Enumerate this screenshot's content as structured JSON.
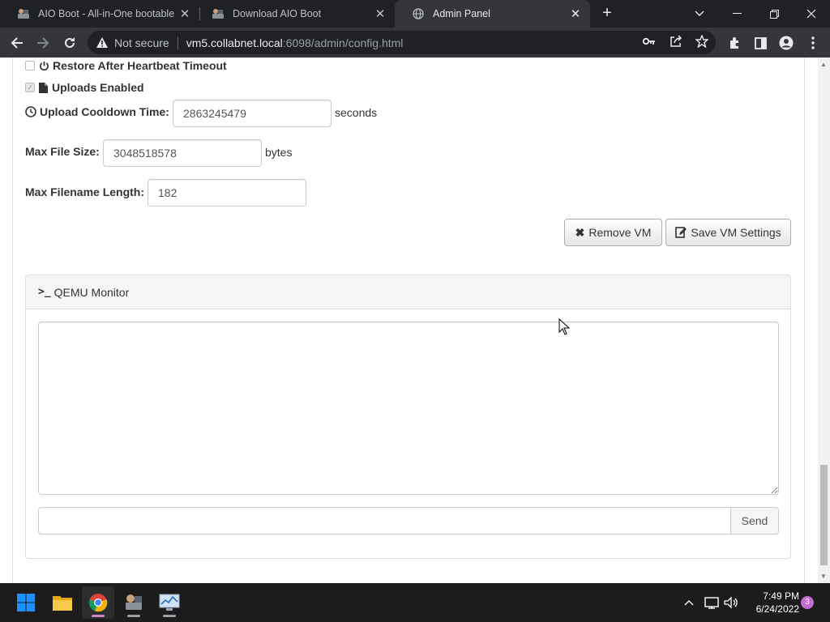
{
  "browser": {
    "tabs": [
      {
        "title": "AIO Boot - All-in-One bootable s",
        "icon": "aio-boot-favicon"
      },
      {
        "title": "Download AIO Boot",
        "icon": "aio-boot-favicon"
      },
      {
        "title": "Admin Panel",
        "icon": "globe-icon"
      }
    ],
    "address": {
      "security_label": "Not secure",
      "host": "vm5.collabnet.local",
      "rest": ":6098/admin/config.html"
    }
  },
  "form": {
    "restore_after_heartbeat": {
      "label": "Restore After Heartbeat Timeout",
      "checked": false
    },
    "uploads_enabled": {
      "label": "Uploads Enabled",
      "checked": true
    },
    "upload_cooldown": {
      "label": "Upload Cooldown Time:",
      "value": "2863245479",
      "unit": "seconds"
    },
    "max_file_size": {
      "label": "Max File Size:",
      "value": "3048518578",
      "unit": "bytes"
    },
    "max_filename_length": {
      "label": "Max Filename Length:",
      "value": "182"
    },
    "remove_vm_label": "Remove VM",
    "save_vm_label": "Save VM Settings"
  },
  "qemu": {
    "title": "QEMU Monitor",
    "prompt_symbol": ">_",
    "output": "",
    "command": "",
    "send_label": "Send"
  },
  "taskbar": {
    "time": "7:49 PM",
    "date": "6/24/2022",
    "notifications": "3"
  }
}
